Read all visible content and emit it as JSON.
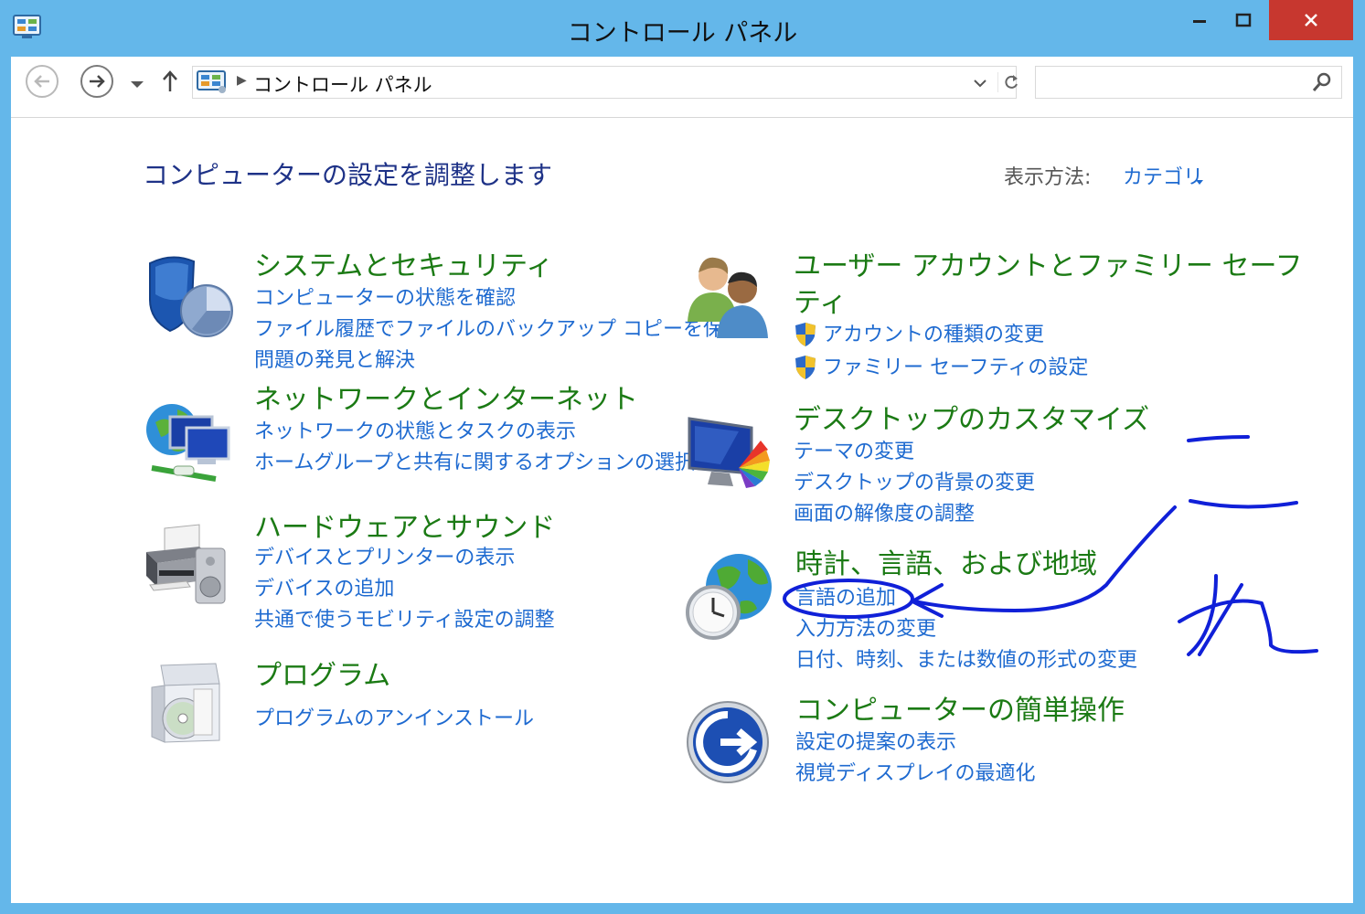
{
  "window": {
    "title": "コントロール パネル"
  },
  "address": {
    "path": "コントロール パネル",
    "search_placeholder": ""
  },
  "header": {
    "heading": "コンピューターの設定を調整します",
    "view_by_label": "表示方法:",
    "view_by_value": "カテゴリ"
  },
  "categories": [
    {
      "title": "システムとセキュリティ",
      "links": [
        "コンピューターの状態を確認",
        "ファイル履歴でファイルのバックアップ コピーを保存",
        "問題の発見と解決"
      ]
    },
    {
      "title": "ネットワークとインターネット",
      "links": [
        "ネットワークの状態とタスクの表示",
        "ホームグループと共有に関するオプションの選択"
      ]
    },
    {
      "title": "ハードウェアとサウンド",
      "links": [
        "デバイスとプリンターの表示",
        "デバイスの追加",
        "共通で使うモビリティ設定の調整"
      ]
    },
    {
      "title": "プログラム",
      "links": [
        "プログラムのアンインストール"
      ]
    },
    {
      "title_line1": "ユーザー アカウントとファミリー セーフ",
      "title_line2": "ティ",
      "links": [
        "アカウントの種類の変更",
        "ファミリー セーフティの設定"
      ]
    },
    {
      "title": "デスクトップのカスタマイズ",
      "links": [
        "テーマの変更",
        "デスクトップの背景の変更",
        "画面の解像度の調整"
      ]
    },
    {
      "title": "時計、言語、および地域",
      "links": [
        "言語の追加",
        "入力方法の変更",
        "日付、時刻、または数値の形式の変更"
      ]
    },
    {
      "title": "コンピューターの簡単操作",
      "links": [
        "設定の提案の表示",
        "視覚ディスプレイの最適化"
      ]
    }
  ],
  "colors": {
    "titlebar": "#64b7ea",
    "close": "#c7372f",
    "category_title": "#1b7a14",
    "link": "#1e6ad0",
    "heading": "#1e3287",
    "annotation_ink": "#1020d8"
  },
  "icons": [
    "app-control-panel-icon",
    "back-arrow-icon",
    "forward-arrow-icon",
    "dropdown-icon",
    "up-arrow-icon",
    "refresh-icon",
    "search-icon",
    "shield-security-icon",
    "network-globe-icon",
    "printer-icon",
    "program-box-icon",
    "users-icon",
    "uac-shield-icon",
    "desktop-monitor-icon",
    "globe-clock-icon",
    "ease-of-access-icon"
  ]
}
